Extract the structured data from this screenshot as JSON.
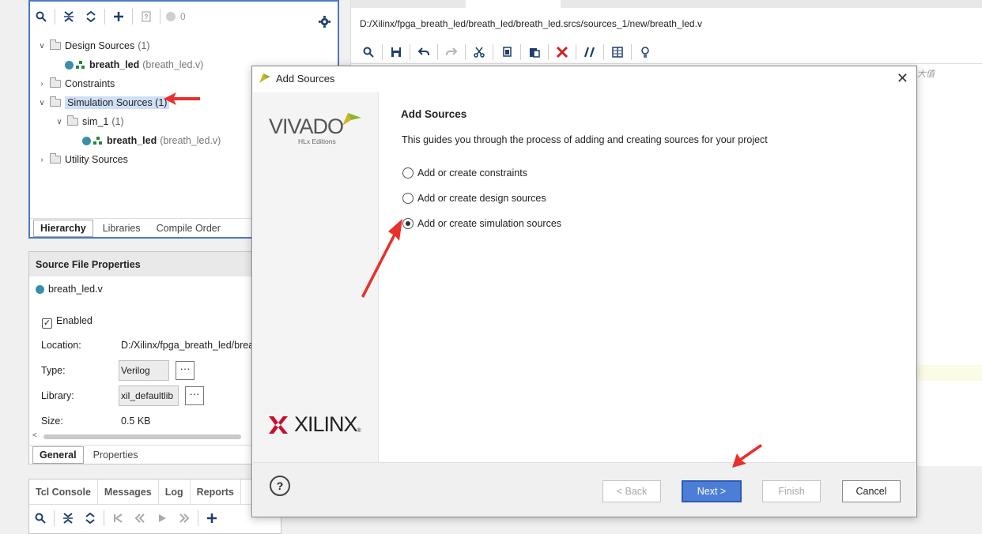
{
  "sources_panel": {
    "toolbar_count": "0",
    "tree": {
      "design": {
        "label": "Design Sources",
        "count": "(1)",
        "file": "breath_led",
        "file_sub": "(breath_led.v)"
      },
      "constraints": {
        "label": "Constraints"
      },
      "simulation": {
        "label": "Simulation Sources (1)"
      },
      "sim1": {
        "label": "sim_1",
        "count": "(1)",
        "file": "breath_led",
        "file_sub": "(breath_led.v)"
      },
      "utility": {
        "label": "Utility Sources"
      }
    },
    "tabs": [
      "Hierarchy",
      "Libraries",
      "Compile Order"
    ]
  },
  "properties": {
    "title": "Source File Properties",
    "file": "breath_led.v",
    "enabled_label": "Enabled",
    "location_label": "Location:",
    "location_value": "D:/Xilinx/fpga_breath_led/breat",
    "type_label": "Type:",
    "type_value": "Verilog",
    "library_label": "Library:",
    "library_value": "xil_defaultlib",
    "size_label": "Size:",
    "size_value": "0.5 KB",
    "more": "···",
    "tabs": [
      "General",
      "Properties"
    ]
  },
  "console": {
    "tabs": [
      "Tcl Console",
      "Messages",
      "Log",
      "Reports"
    ]
  },
  "editor": {
    "path": "D:/Xilinx/fpga_breath_led/breath_led/breath_led.srcs/sources_1/new/breath_led.v",
    "side_text": "大值"
  },
  "dialog": {
    "window_title": "Add Sources",
    "heading": "Add Sources",
    "description": "This guides you through the process of adding and creating sources for your project",
    "logo_text": "VIVADO",
    "logo_sub": "HLx Editions",
    "xilinx_text": "XILINX",
    "options": [
      {
        "label": "Add or create constraints",
        "selected": false
      },
      {
        "label": "Add or create design sources",
        "selected": false
      },
      {
        "label": "Add or create simulation sources",
        "selected": true
      }
    ],
    "buttons": {
      "help": "?",
      "back": "< Back",
      "next": "Next >",
      "finish": "Finish",
      "cancel": "Cancel"
    }
  },
  "colors": {
    "accent": "#4d7ed6",
    "annotation": "#e8302c",
    "file_dot": "#3a8fa8",
    "vivado_green": "#8db52a"
  }
}
